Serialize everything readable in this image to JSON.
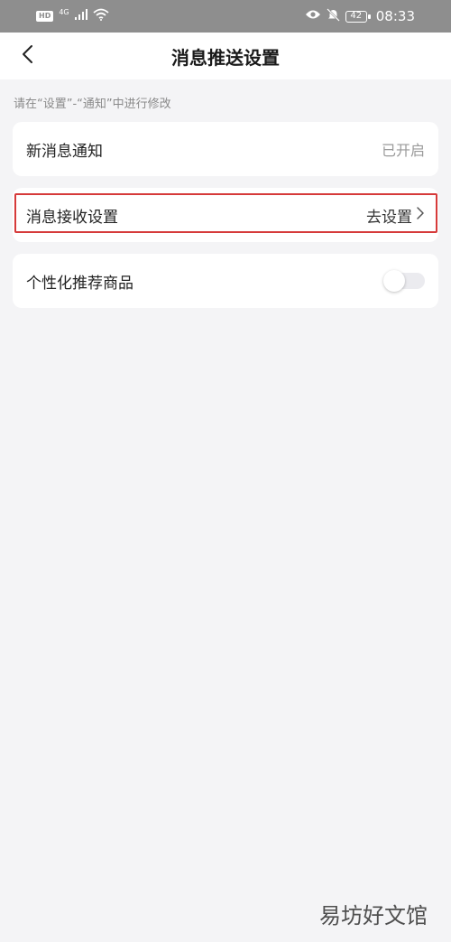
{
  "status_bar": {
    "left_badge": "HD",
    "network": "4G",
    "battery": "42",
    "time": "08:33"
  },
  "nav": {
    "title": "消息推送设置"
  },
  "hint": "请在“设置”-“通知”中进行修改",
  "rows": [
    {
      "label": "新消息通知",
      "value": "已开启"
    },
    {
      "label": "消息接收设置",
      "value": "去设置"
    },
    {
      "label": "个性化推荐商品",
      "toggle_on": false
    }
  ],
  "watermark": "易坊好文馆",
  "colors": {
    "highlight": "#d63a3a",
    "background": "#f4f4f6",
    "status_bar": "#8e8e8e"
  }
}
